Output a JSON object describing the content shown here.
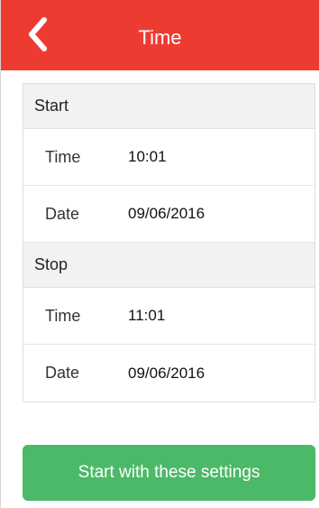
{
  "header": {
    "title": "Time",
    "back_icon": "chevron-left-icon",
    "color": "#ee3b32"
  },
  "start": {
    "heading": "Start",
    "time_label": "Time",
    "time_value": "10:01",
    "date_label": "Date",
    "date_value": "09/06/2016"
  },
  "stop": {
    "heading": "Stop",
    "time_label": "Time",
    "time_value": "11:01",
    "date_label": "Date",
    "date_value": "09/06/2016"
  },
  "action": {
    "label": "Start with these settings",
    "color": "#4cb968"
  }
}
